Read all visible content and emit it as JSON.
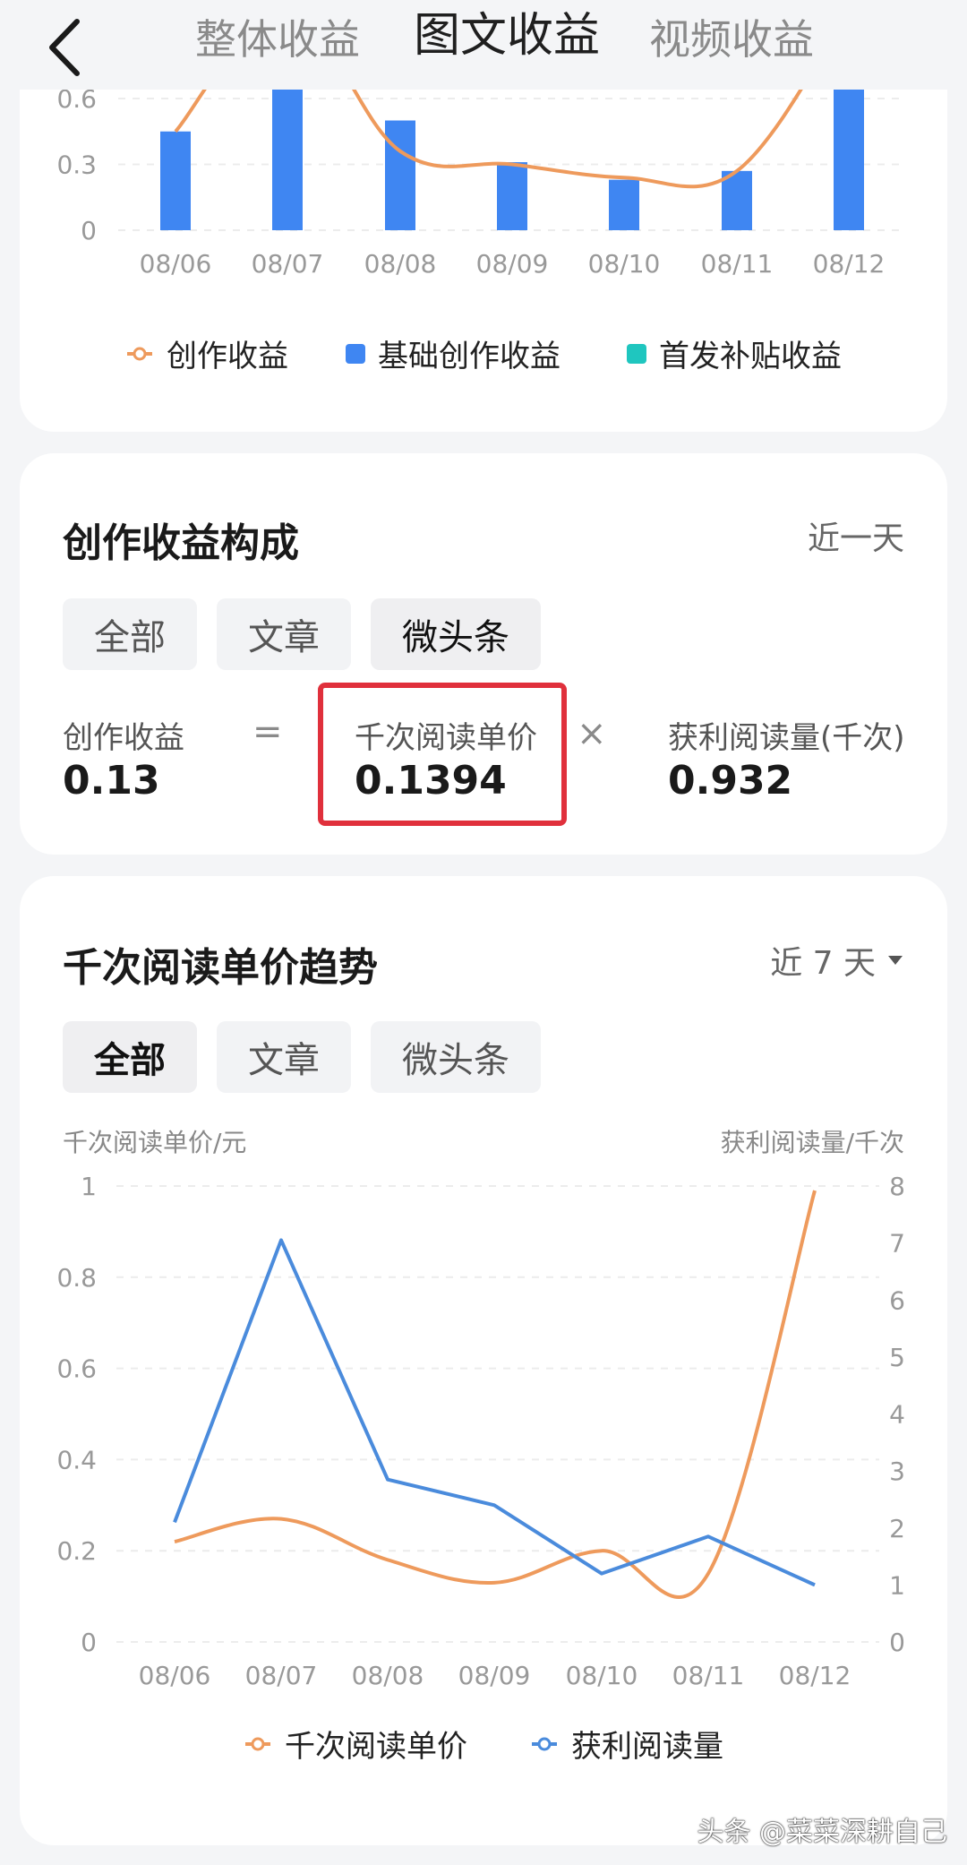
{
  "header": {
    "tabs": [
      {
        "label": "整体收益"
      },
      {
        "label": "图文收益"
      },
      {
        "label": "视频收益"
      }
    ],
    "active_tab": 1
  },
  "top_chart": {
    "legend": [
      "创作收益",
      "基础创作收益",
      "首发补贴收益"
    ],
    "colors": {
      "line": "#ee9a5c",
      "bar": "#3f86f2",
      "subsidy": "#1fc6bf"
    },
    "chart_data": {
      "type": "bar",
      "categories": [
        "08/06",
        "08/07",
        "08/08",
        "08/09",
        "08/10",
        "08/11",
        "08/12"
      ],
      "y_ticks": [
        "0",
        "0.3",
        "0.6"
      ],
      "series": [
        {
          "name": "基础创作收益",
          "type": "bar",
          "values": [
            0.45,
            0.75,
            0.5,
            0.31,
            0.23,
            0.27,
            0.75
          ]
        },
        {
          "name": "创作收益",
          "type": "line",
          "values": [
            0.45,
            0.75,
            0.36,
            0.3,
            0.24,
            0.27,
            0.75
          ]
        }
      ],
      "ylim": [
        0,
        0.6
      ]
    }
  },
  "composition": {
    "title": "创作收益构成",
    "range": "近一天",
    "filters": [
      "全部",
      "文章",
      "微头条"
    ],
    "active_filter": 2,
    "income_label": "创作收益",
    "income_value": "0.13",
    "eq": "=",
    "price_label": "千次阅读单价",
    "price_value": "0.1394",
    "times": "×",
    "reads_label": "获利阅读量(千次)",
    "reads_value": "0.932"
  },
  "trend": {
    "title": "千次阅读单价趋势",
    "range": "近 7 天",
    "filters": [
      "全部",
      "文章",
      "微头条"
    ],
    "active_filter": 0,
    "left_axis_title": "千次阅读单价/元",
    "right_axis_title": "获利阅读量/千次",
    "legend": [
      "千次阅读单价",
      "获利阅读量"
    ],
    "colors": {
      "price": "#ee9a5c",
      "reads": "#4a8bdc"
    },
    "chart_data": {
      "type": "line",
      "categories": [
        "08/06",
        "08/07",
        "08/08",
        "08/09",
        "08/10",
        "08/11",
        "08/12"
      ],
      "y_ticks_left": [
        "0",
        "0.2",
        "0.4",
        "0.6",
        "0.8",
        "1"
      ],
      "y_ticks_right": [
        "0",
        "1",
        "2",
        "3",
        "4",
        "5",
        "6",
        "7",
        "8"
      ],
      "series": [
        {
          "name": "千次阅读单价",
          "axis": "left",
          "values": [
            0.22,
            0.27,
            0.18,
            0.13,
            0.2,
            0.15,
            0.99
          ]
        },
        {
          "name": "获利阅读量",
          "axis": "right",
          "values": [
            2.1,
            7.05,
            2.85,
            2.4,
            1.2,
            1.85,
            1.0
          ]
        }
      ],
      "ylim_left": [
        0,
        1
      ],
      "ylim_right": [
        0,
        8
      ]
    }
  },
  "watermark": "头条 @菜菜深耕自己"
}
